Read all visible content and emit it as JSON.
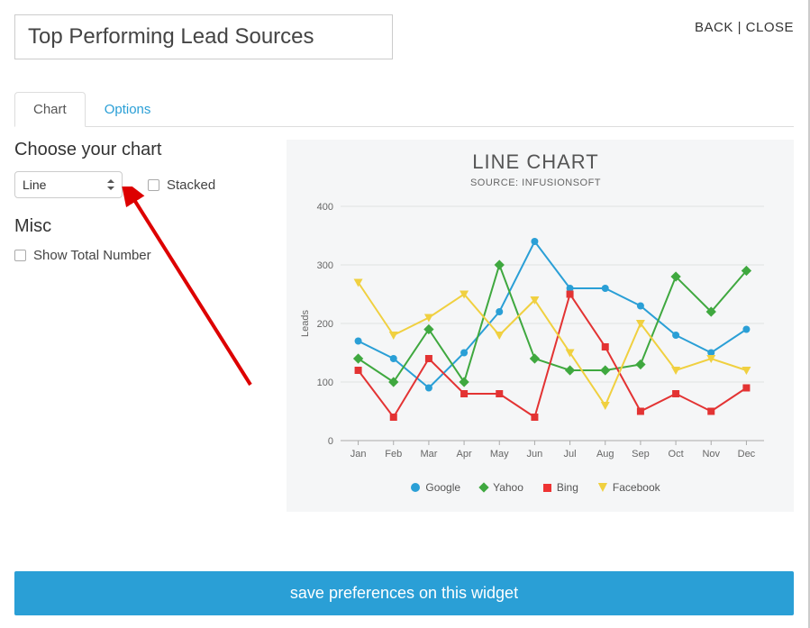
{
  "header": {
    "title_value": "Top Performing Lead Sources",
    "back_label": "BACK",
    "close_label": "CLOSE"
  },
  "tabs": {
    "chart": "Chart",
    "options": "Options"
  },
  "controls": {
    "choose_heading": "Choose your chart",
    "chart_type_value": "Line",
    "stacked_label": "Stacked",
    "misc_heading": "Misc",
    "show_total_label": "Show Total Number"
  },
  "chart": {
    "title": "LINE CHART",
    "subtitle": "SOURCE: INFUSIONSOFT",
    "ylabel": "Leads"
  },
  "legend": {
    "google": "Google",
    "yahoo": "Yahoo",
    "bing": "Bing",
    "facebook": "Facebook"
  },
  "footer": {
    "save_label": "save preferences on this widget"
  },
  "chart_data": {
    "type": "line",
    "title": "LINE CHART",
    "subtitle": "SOURCE: INFUSIONSOFT",
    "xlabel": "",
    "ylabel": "Leads",
    "ylim": [
      0,
      400
    ],
    "yticks": [
      0,
      100,
      200,
      300,
      400
    ],
    "categories": [
      "Jan",
      "Feb",
      "Mar",
      "Apr",
      "May",
      "Jun",
      "Jul",
      "Aug",
      "Sep",
      "Oct",
      "Nov",
      "Dec"
    ],
    "series": [
      {
        "name": "Google",
        "color": "#2a9fd6",
        "marker": "circle",
        "values": [
          170,
          140,
          90,
          150,
          220,
          340,
          260,
          260,
          230,
          180,
          150,
          190
        ]
      },
      {
        "name": "Yahoo",
        "color": "#3fa83f",
        "marker": "diamond",
        "values": [
          140,
          100,
          190,
          100,
          300,
          140,
          120,
          120,
          130,
          280,
          220,
          290
        ]
      },
      {
        "name": "Bing",
        "color": "#e33333",
        "marker": "square",
        "values": [
          120,
          40,
          140,
          80,
          80,
          40,
          250,
          160,
          50,
          80,
          50,
          90
        ]
      },
      {
        "name": "Facebook",
        "color": "#f0d040",
        "marker": "triangle-down",
        "values": [
          270,
          180,
          210,
          250,
          180,
          240,
          150,
          60,
          200,
          120,
          140,
          120
        ]
      }
    ]
  }
}
